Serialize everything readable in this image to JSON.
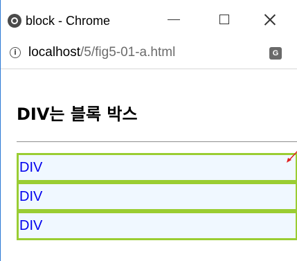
{
  "window": {
    "title": "block - Chrome"
  },
  "address_bar": {
    "host": "localhost",
    "path": "/5/fig5-01-a.html"
  },
  "page": {
    "heading": "DIV는 블록 박스",
    "blocks": [
      {
        "label": "DIV"
      },
      {
        "label": "DIV"
      },
      {
        "label": "DIV"
      }
    ]
  },
  "colors": {
    "block_border": "#9acd32",
    "block_background": "#f0f8ff",
    "block_text": "#0000ee",
    "annotation_arrow": "#e02020"
  },
  "icons": {
    "title": "chrome-logo-icon",
    "info": "info-icon",
    "translate": "translate-icon"
  }
}
